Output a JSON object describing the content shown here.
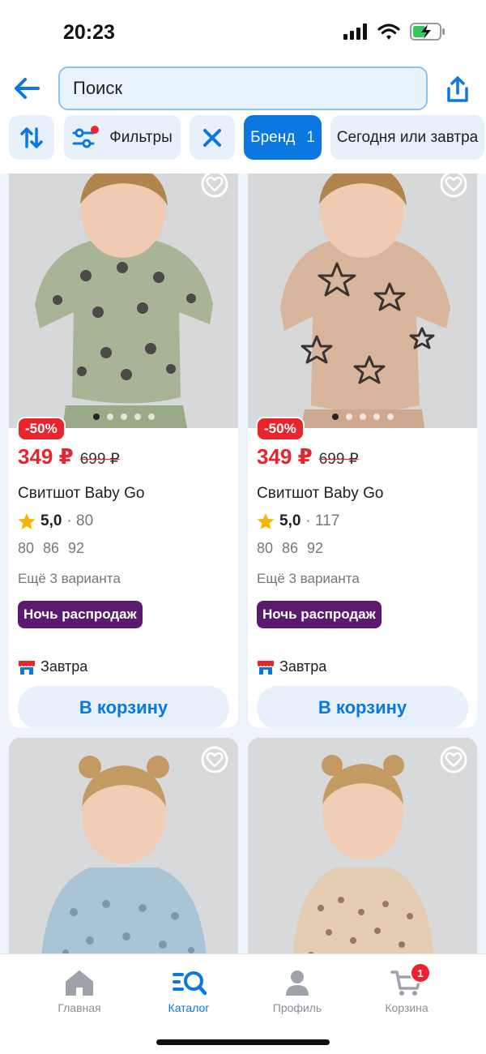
{
  "status_bar": {
    "time": "20:23",
    "icons": [
      "signal-icon",
      "wifi-icon",
      "battery-charging-icon"
    ]
  },
  "search": {
    "placeholder": "Поиск",
    "back_icon": "arrow-left-icon",
    "share_icon": "share-icon"
  },
  "filters": {
    "sort_icon": "sort-icon",
    "filters_label": "Фильтры",
    "filters_icon": "filter-sliders-icon",
    "clear_icon": "close-icon",
    "brand_label": "Бренд",
    "brand_count": "1",
    "date_label": "Сегодня или завтра"
  },
  "colors": {
    "accent": "#0a78e0",
    "sale_red": "#e8242c",
    "promo_purple": "#5a1b6e",
    "chip_bg": "#e8f1fb"
  },
  "products": [
    {
      "discount": "-50%",
      "price": "349 ₽",
      "old_price": "699 ₽",
      "title": "Свитшот Baby Go",
      "rating": "5,0",
      "reviews": "· 80",
      "sizes": "80 86 92",
      "variants": "Ещё 3 варианта",
      "promo": "Ночь распродаж",
      "delivery": "Завтра",
      "cart_label": "В корзину",
      "image_colors": {
        "bg": "#d7d8da",
        "shirt": "#a7b596"
      }
    },
    {
      "discount": "-50%",
      "price": "349 ₽",
      "old_price": "699 ₽",
      "title": "Свитшот Baby Go",
      "rating": "5,0",
      "reviews": "· 117",
      "sizes": "80 86 92",
      "variants": "Ещё 3 варианта",
      "promo": "Ночь распродаж",
      "delivery": "Завтра",
      "cart_label": "В корзину",
      "image_colors": {
        "bg": "#d7d8da",
        "shirt": "#d9b59c"
      }
    },
    {
      "image_colors": {
        "bg": "#d8d9db",
        "shirt": "#a9c4d4"
      }
    },
    {
      "image_colors": {
        "bg": "#d8d9db",
        "shirt": "#e5cdb4"
      }
    }
  ],
  "bottom_nav": {
    "items": [
      {
        "label": "Главная",
        "icon": "home-icon"
      },
      {
        "label": "Каталог",
        "icon": "catalog-search-icon"
      },
      {
        "label": "Профиль",
        "icon": "profile-icon"
      },
      {
        "label": "Корзина",
        "icon": "cart-icon",
        "badge": "1"
      }
    ],
    "active": "Каталог"
  }
}
